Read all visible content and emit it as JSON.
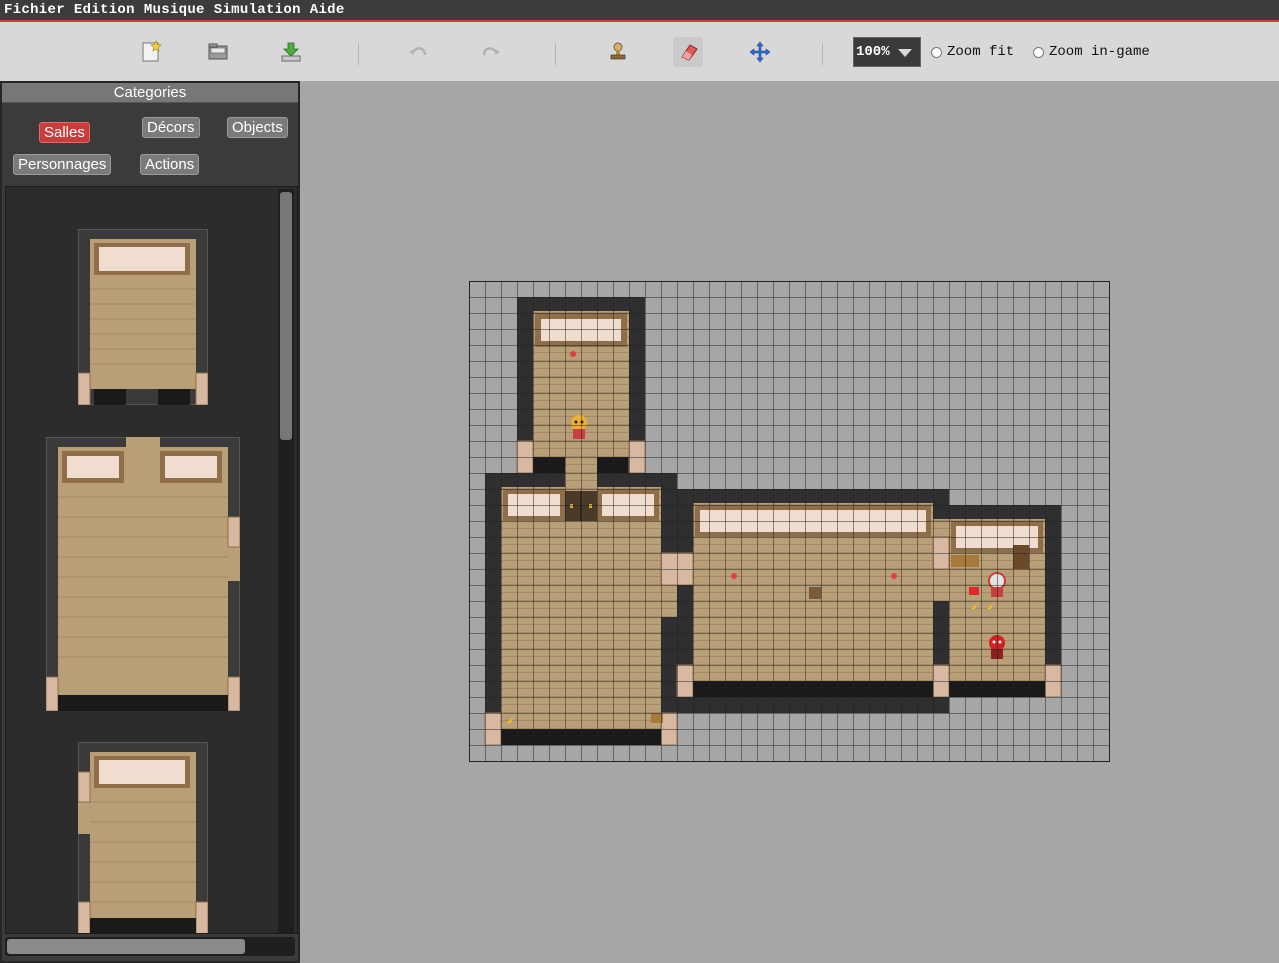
{
  "menubar": {
    "items": [
      "Fichier",
      "Edition",
      "Musique",
      "Simulation",
      "Aide"
    ]
  },
  "toolbar": {
    "buttons": [
      {
        "name": "new-map-button",
        "icon": "new-document-icon"
      },
      {
        "name": "open-button",
        "icon": "folder-icon"
      },
      {
        "name": "save-button",
        "icon": "download-arrow-icon"
      },
      {
        "name": "undo-button",
        "icon": "undo-arrow-icon"
      },
      {
        "name": "redo-button",
        "icon": "redo-arrow-icon"
      },
      {
        "name": "stamp-tool-button",
        "icon": "stamp-icon"
      },
      {
        "name": "eraser-tool-button",
        "icon": "eraser-icon"
      },
      {
        "name": "move-tool-button",
        "icon": "move-arrows-icon"
      }
    ],
    "zoom_value": "100%",
    "zoom_fit_label": "Zoom fit",
    "zoom_ingame_label": "Zoom in-game"
  },
  "sidebar": {
    "header": "Categories",
    "categories": [
      {
        "label": "Salles",
        "active": true
      },
      {
        "label": "Décors",
        "active": false
      },
      {
        "label": "Objects",
        "active": false
      },
      {
        "label": "Personnages",
        "active": false
      },
      {
        "label": "Actions",
        "active": false
      }
    ]
  },
  "colors": {
    "accent": "#d83a3a",
    "wall": "#2f2f2f",
    "floor": "#b89f78",
    "window_frame": "#8f6f4a",
    "window_glass": "#f1ddd0",
    "grid_line": "#222222",
    "canvas_bg": "#a6a6a6"
  }
}
